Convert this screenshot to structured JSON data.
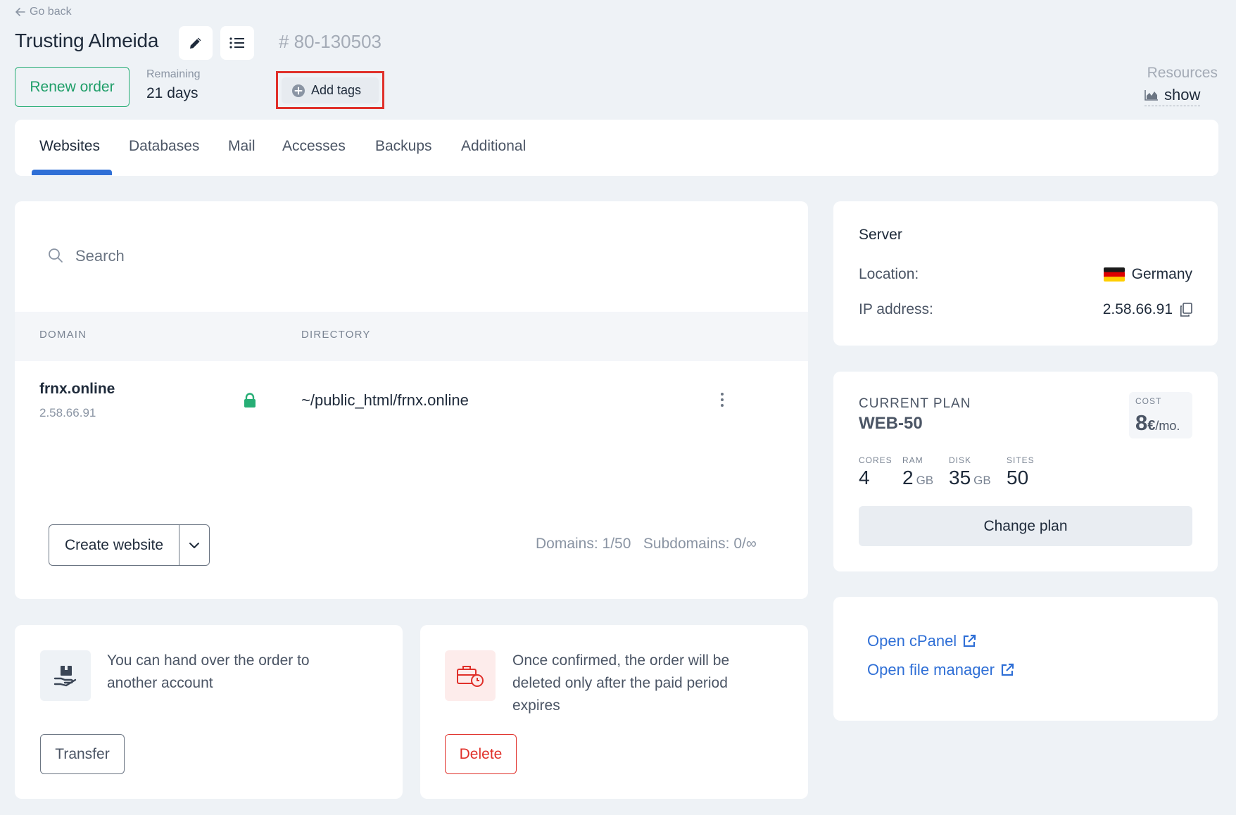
{
  "header": {
    "go_back": "Go back",
    "title": "Trusting Almeida",
    "order_number": "# 80-130503",
    "renew_label": "Renew order",
    "remaining_label": "Remaining",
    "remaining_value": "21 days",
    "add_tags_label": "Add tags",
    "resources_label": "Resources",
    "resources_show": "show"
  },
  "tabs": [
    {
      "label": "Websites",
      "active": true
    },
    {
      "label": "Databases",
      "active": false
    },
    {
      "label": "Mail",
      "active": false
    },
    {
      "label": "Accesses",
      "active": false
    },
    {
      "label": "Backups",
      "active": false
    },
    {
      "label": "Additional",
      "active": false
    }
  ],
  "websites": {
    "search_placeholder": "Search",
    "columns": [
      "DOMAIN",
      "DIRECTORY"
    ],
    "rows": [
      {
        "domain": "frnx.online",
        "ip": "2.58.66.91",
        "directory": "~/public_html/frnx.online",
        "ssl": true
      }
    ],
    "create_label": "Create website",
    "domains_count": "Domains: 1/50",
    "subdomains_count": "Subdomains: 0/∞"
  },
  "transfer_card": {
    "text": "You can hand over the order to another account",
    "button": "Transfer"
  },
  "delete_card": {
    "text": "Once confirmed, the order will be deleted only after the paid period expires",
    "button": "Delete"
  },
  "server": {
    "title": "Server",
    "location_label": "Location:",
    "location_value": "Germany",
    "ip_label": "IP address:",
    "ip_value": "2.58.66.91"
  },
  "plan": {
    "label": "CURRENT PLAN",
    "name": "WEB-50",
    "cost_label": "COST",
    "cost_value": "8",
    "cost_currency": "€",
    "cost_unit": "/mo.",
    "specs": [
      {
        "label": "CORES",
        "value": "4",
        "unit": ""
      },
      {
        "label": "RAM",
        "value": "2",
        "unit": "GB"
      },
      {
        "label": "DISK",
        "value": "35",
        "unit": "GB"
      },
      {
        "label": "SITES",
        "value": "50",
        "unit": ""
      }
    ],
    "change_label": "Change plan"
  },
  "links": {
    "cpanel": "Open cPanel",
    "file_manager": "Open file manager"
  },
  "colors": {
    "accent_blue": "#2f6fd6",
    "success_green": "#27ae75",
    "danger_red": "#e0302a",
    "background": "#eef2f6"
  }
}
